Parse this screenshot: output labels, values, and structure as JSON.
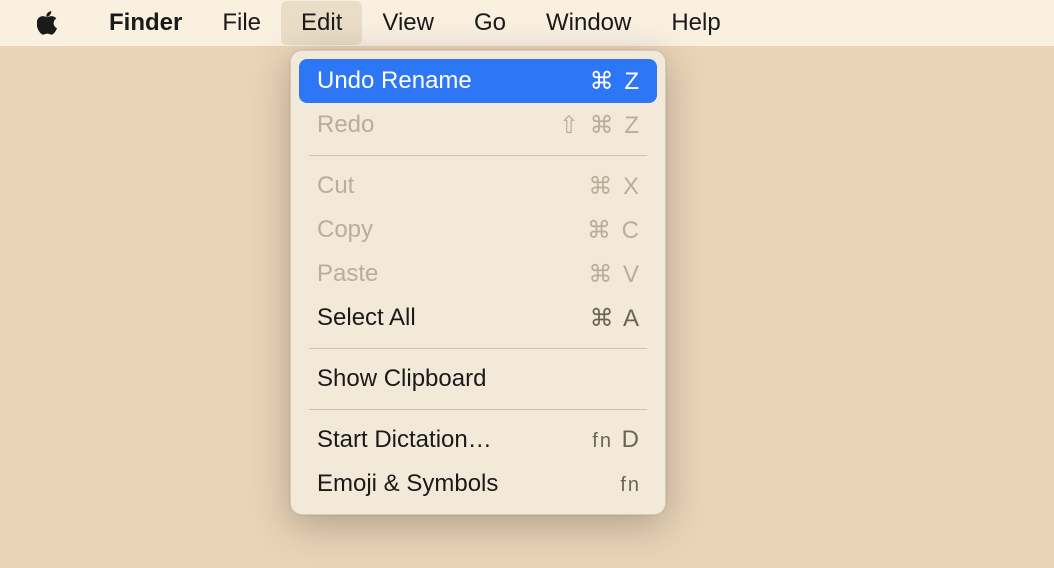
{
  "menubar": {
    "app": "Finder",
    "items": [
      "File",
      "Edit",
      "View",
      "Go",
      "Window",
      "Help"
    ]
  },
  "dropdown": {
    "undo": {
      "label": "Undo Rename",
      "shortcut": "⌘ Z"
    },
    "redo": {
      "label": "Redo",
      "shortcut": "⇧ ⌘ Z"
    },
    "cut": {
      "label": "Cut",
      "shortcut": "⌘ X"
    },
    "copy": {
      "label": "Copy",
      "shortcut": "⌘ C"
    },
    "paste": {
      "label": "Paste",
      "shortcut": "⌘ V"
    },
    "selectAll": {
      "label": "Select All",
      "shortcut": "⌘ A"
    },
    "showClipboard": {
      "label": "Show Clipboard",
      "shortcut": ""
    },
    "startDictation": {
      "label": "Start Dictation…",
      "shortcut_fn": "fn",
      "shortcut_key": "D"
    },
    "emoji": {
      "label": "Emoji & Symbols",
      "shortcut_fn": "fn"
    }
  }
}
